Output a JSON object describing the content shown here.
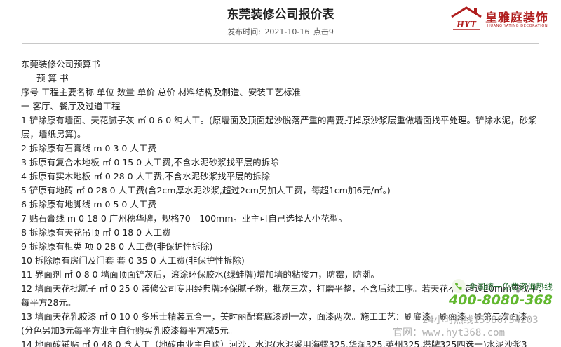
{
  "header": {
    "title": "东莞装修公司报价表",
    "publish_label": "发布时间:",
    "publish_date": "2021-10-16",
    "clicks": "点击9"
  },
  "logo": {
    "mark": "HYT",
    "name": "皇雅庭装饰",
    "en": "HUANG YATING DECORATION"
  },
  "document": {
    "lines": [
      "东莞装修公司预算书",
      "预 算 书",
      "序号 工程主要名称 单位 数量 单价 总价 材料结构及制造、安装工艺标准",
      "一 客厅、餐厅及过道工程",
      "1 铲除原有墙面、天花腻子灰 ㎡ 0 6 0 纯人工。(原墙面及顶面起沙脱落严重的需要打掉原沙浆层重做墙面找平处理。铲除水泥，砂浆层，墙纸另算)。",
      "2 拆除原有石膏线 m 0 3 0 人工费",
      "3 拆原有复合木地板 ㎡ 0 15 0 人工费,不含水泥砂浆找平层的拆除",
      "4 拆原有实木地板 ㎡ 0 28 0 人工费,不含水泥砂浆找平层的拆除",
      "5 铲原有地砖 ㎡ 0 28 0 人工费(含2cm厚水泥沙浆,超过2cm另加人工费，每超1cm加6元/㎡。)",
      "6 拆除原有地脚线 m 0 5 0 人工费",
      "7 贴石膏线 m 0 18 0 广州穗华牌，规格70—100mm。业主可自己选择大小花型。",
      "8 拆除原有天花吊顶 ㎡ 0 18 0 人工费",
      "9 拆除原有柜类 项 0 28 0 人工费(非保护性拆除)",
      "10 拆除原有房门及门套 套 0 35 0 人工费(非保护性拆除)",
      "11 界面剂 ㎡ 0 8 0 墙面顶面铲灰后，滚涂环保胶水(绿蛙牌)增加墙的粘接力，防霉，防潮。",
      "12 墙面天花批腻子 ㎡ 0 25 0 装修公司专用经典牌环保腻子粉，批灰三次，打磨平整，不含后续工序。若天花不平超过20mm需找平，每平方28元。",
      "13 墙面天花乳胶漆 ㎡ 0 10 0 多乐士精装五合一，美时丽配套底漆刷一次，面漆两次。施工工艺：刷底漆，刷面漆，刷第二次面漆。(分色另加3元每平方业主自行购买乳胶漆每平方减5元。",
      "14 地面砖铺贴 ㎡ 0 48 0 含人工（地砖由业主自购）河沙，水泥(水泥采用海螺325,华润325,英州325,塔牌325四选一)水泥沙浆3"
    ]
  },
  "floating": {
    "label": "全国统一免费咨询热线",
    "phone": "400-8080-368",
    "watermark_1": "24小时热线15986754203",
    "watermark_2": "官网：www.hyt368.com"
  }
}
